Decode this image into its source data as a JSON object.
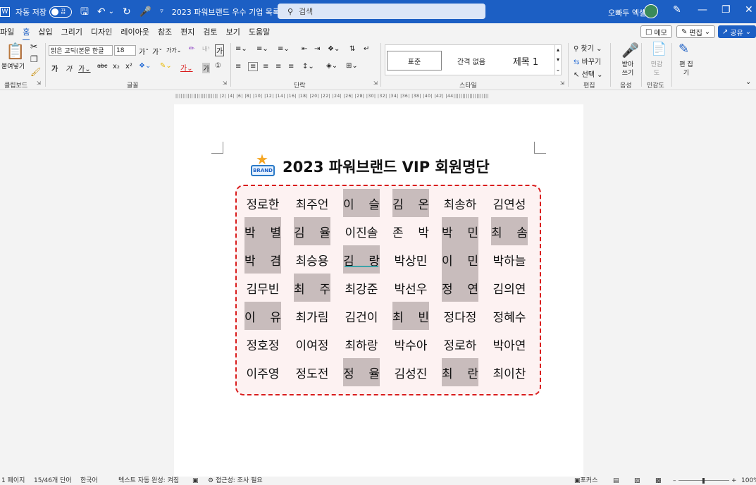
{
  "titlebar": {
    "autosave_label": "자동 저장",
    "autosave_toggle": "끔",
    "doc_title": "2023 파워브랜드 우수 기업 목록...",
    "search_placeholder": "검색",
    "user_name": "오빠두 엑셀"
  },
  "menu": {
    "tabs": [
      "파일",
      "홈",
      "삽입",
      "그리기",
      "디자인",
      "레이아웃",
      "참조",
      "편지",
      "검토",
      "보기",
      "도움말"
    ],
    "active_tab": "홈",
    "memo_label": "메모",
    "edit_label": "편집",
    "share_label": "공유"
  },
  "ribbon": {
    "paste_label": "붙여넣기",
    "font_name": "맑은 고딕(본문 한글",
    "font_size": "18",
    "styles": [
      "표준",
      "간격 없음",
      "제목 1"
    ],
    "find_label": "찾기",
    "replace_label": "바꾸기",
    "select_label": "선택",
    "dictate_label": "받아 쓰기",
    "sensitivity_label": "민감 도",
    "editor_label": "편 집기",
    "groups": [
      "클립보드",
      "글꼴",
      "단락",
      "스타일",
      "편집",
      "음성",
      "민감도"
    ]
  },
  "ruler_text": "|||||||||||||||||||||||| |2|  |4|  |6|  |8|  |10|  |12|  |14|  |16|  |18|  |20|  |22|  |24|  |26|  |28|  |30|  |32|  |34|  |36|  |38|  |40|  |42|  |44||||||||||||||||||||",
  "document": {
    "badge_text": "BRAND",
    "title": "2023 파워브랜드 VIP 회원명단",
    "rows": [
      [
        {
          "name": "정로한",
          "hl": false
        },
        {
          "name": "최주언",
          "hl": false
        },
        {
          "name": "이 슬",
          "hl": true
        },
        {
          "name": "김 온",
          "hl": true
        },
        {
          "name": "최송하",
          "hl": false
        },
        {
          "name": "김연성",
          "hl": false
        }
      ],
      [
        {
          "name": "박 별",
          "hl": true
        },
        {
          "name": "김 율",
          "hl": true
        },
        {
          "name": "이진솔",
          "hl": false
        },
        {
          "name": "존 박",
          "hl": false
        },
        {
          "name": "박 민",
          "hl": true
        },
        {
          "name": "최 솜",
          "hl": true
        }
      ],
      [
        {
          "name": "박 겸",
          "hl": true
        },
        {
          "name": "최승용",
          "hl": false
        },
        {
          "name": "김 랑",
          "hl": true,
          "underline": true
        },
        {
          "name": "박상민",
          "hl": false
        },
        {
          "name": "이 민",
          "hl": true
        },
        {
          "name": "박하늘",
          "hl": false
        }
      ],
      [
        {
          "name": "김무빈",
          "hl": false
        },
        {
          "name": "최 주",
          "hl": true
        },
        {
          "name": "최강준",
          "hl": false
        },
        {
          "name": "박선우",
          "hl": false
        },
        {
          "name": "정 연",
          "hl": true
        },
        {
          "name": "김의연",
          "hl": false
        }
      ],
      [
        {
          "name": "이 유",
          "hl": true
        },
        {
          "name": "최가림",
          "hl": false
        },
        {
          "name": "김건이",
          "hl": false
        },
        {
          "name": "최 빈",
          "hl": true
        },
        {
          "name": "정다정",
          "hl": false
        },
        {
          "name": "정혜수",
          "hl": false
        }
      ],
      [
        {
          "name": "정호정",
          "hl": false
        },
        {
          "name": "이여정",
          "hl": false
        },
        {
          "name": "최하랑",
          "hl": false
        },
        {
          "name": "박수아",
          "hl": false
        },
        {
          "name": "정로하",
          "hl": false
        },
        {
          "name": "박아연",
          "hl": false
        }
      ],
      [
        {
          "name": "이주영",
          "hl": false
        },
        {
          "name": "정도전",
          "hl": false
        },
        {
          "name": "정 율",
          "hl": true
        },
        {
          "name": "김성진",
          "hl": false
        },
        {
          "name": "최 란",
          "hl": true
        },
        {
          "name": "최이찬",
          "hl": false
        }
      ]
    ]
  },
  "statusbar": {
    "page": "1 페이지",
    "words": "15/46개 단어",
    "language": "한국어",
    "autocomplete": "텍스트 자동 완성: 켜짐",
    "accessibility": "접근성: 조사 필요",
    "focus": "포커스",
    "zoom": "100%"
  },
  "colors": {
    "accent": "#1c5fc4",
    "highlight": "#c8bcbc",
    "border_dashed": "#d91c1c",
    "box_fill": "#fdf2f2"
  }
}
